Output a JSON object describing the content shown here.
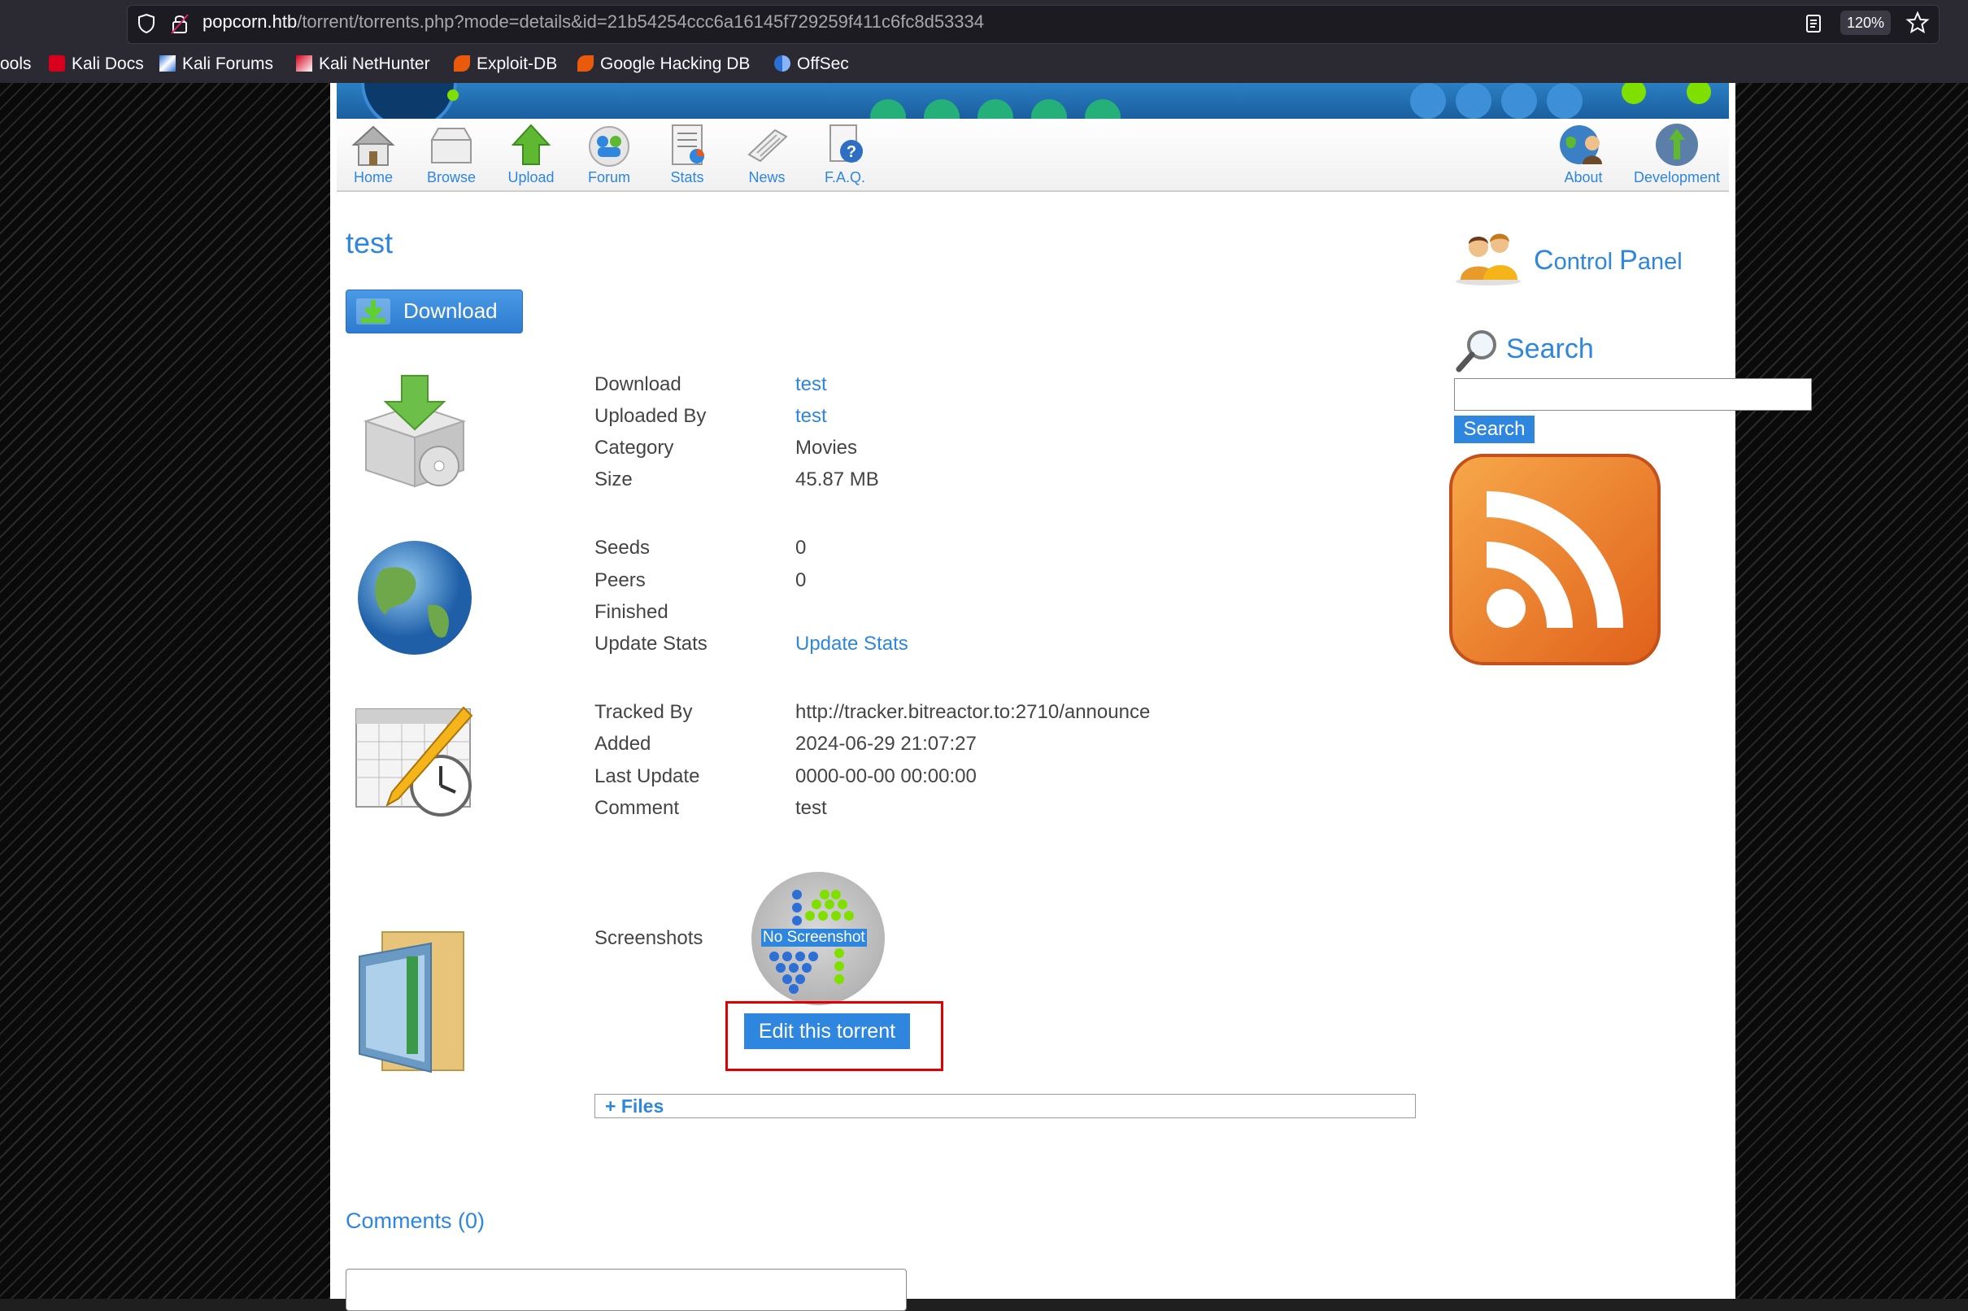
{
  "browser": {
    "url_host": "popcorn.htb",
    "url_path": "/torrent/torrents.php?mode=details&id=21b54254ccc6a16145f729259f411c6fc8d53334",
    "zoom": "120%",
    "bookmarks": [
      "ools",
      "Kali Docs",
      "Kali Forums",
      "Kali NetHunter",
      "Exploit-DB",
      "Google Hacking DB",
      "OffSec"
    ]
  },
  "nav": {
    "items": [
      "Home",
      "Browse",
      "Upload",
      "Forum",
      "Stats",
      "News",
      "F.A.Q."
    ],
    "right_items": [
      "About",
      "Development"
    ]
  },
  "torrent": {
    "title": "test",
    "download_button": "Download",
    "info1": [
      {
        "label": "Download",
        "value": "test"
      },
      {
        "label": "Uploaded By",
        "value": "test"
      },
      {
        "label": "Category",
        "value": "Movies"
      },
      {
        "label": "Size",
        "value": "45.87 MB"
      }
    ],
    "info2": [
      {
        "label": "Seeds",
        "value": "0"
      },
      {
        "label": "Peers",
        "value": "0"
      },
      {
        "label": "Finished",
        "value": ""
      },
      {
        "label": "Update Stats",
        "value": "Update Stats"
      }
    ],
    "info3": [
      {
        "label": "Tracked By",
        "value": "http://tracker.bitreactor.to:2710/announce"
      },
      {
        "label": "Added",
        "value": "2024-06-29 21:07:27"
      },
      {
        "label": "Last Update",
        "value": "0000-00-00 00:00:00"
      },
      {
        "label": "Comment",
        "value": "test"
      }
    ],
    "screenshots_label": "Screenshots",
    "no_screenshot_text": "No Screenshot",
    "edit_button": "Edit this torrent",
    "files_toggle": "+ Files",
    "comments_link": "Comments (0)"
  },
  "sidebar": {
    "control_panel": {
      "first_letter_1": "C",
      "rest_1": "ontrol ",
      "first_letter_2": "P",
      "rest_2": "anel"
    },
    "search_heading": "Search",
    "search_button": "Search",
    "search_value": ""
  }
}
